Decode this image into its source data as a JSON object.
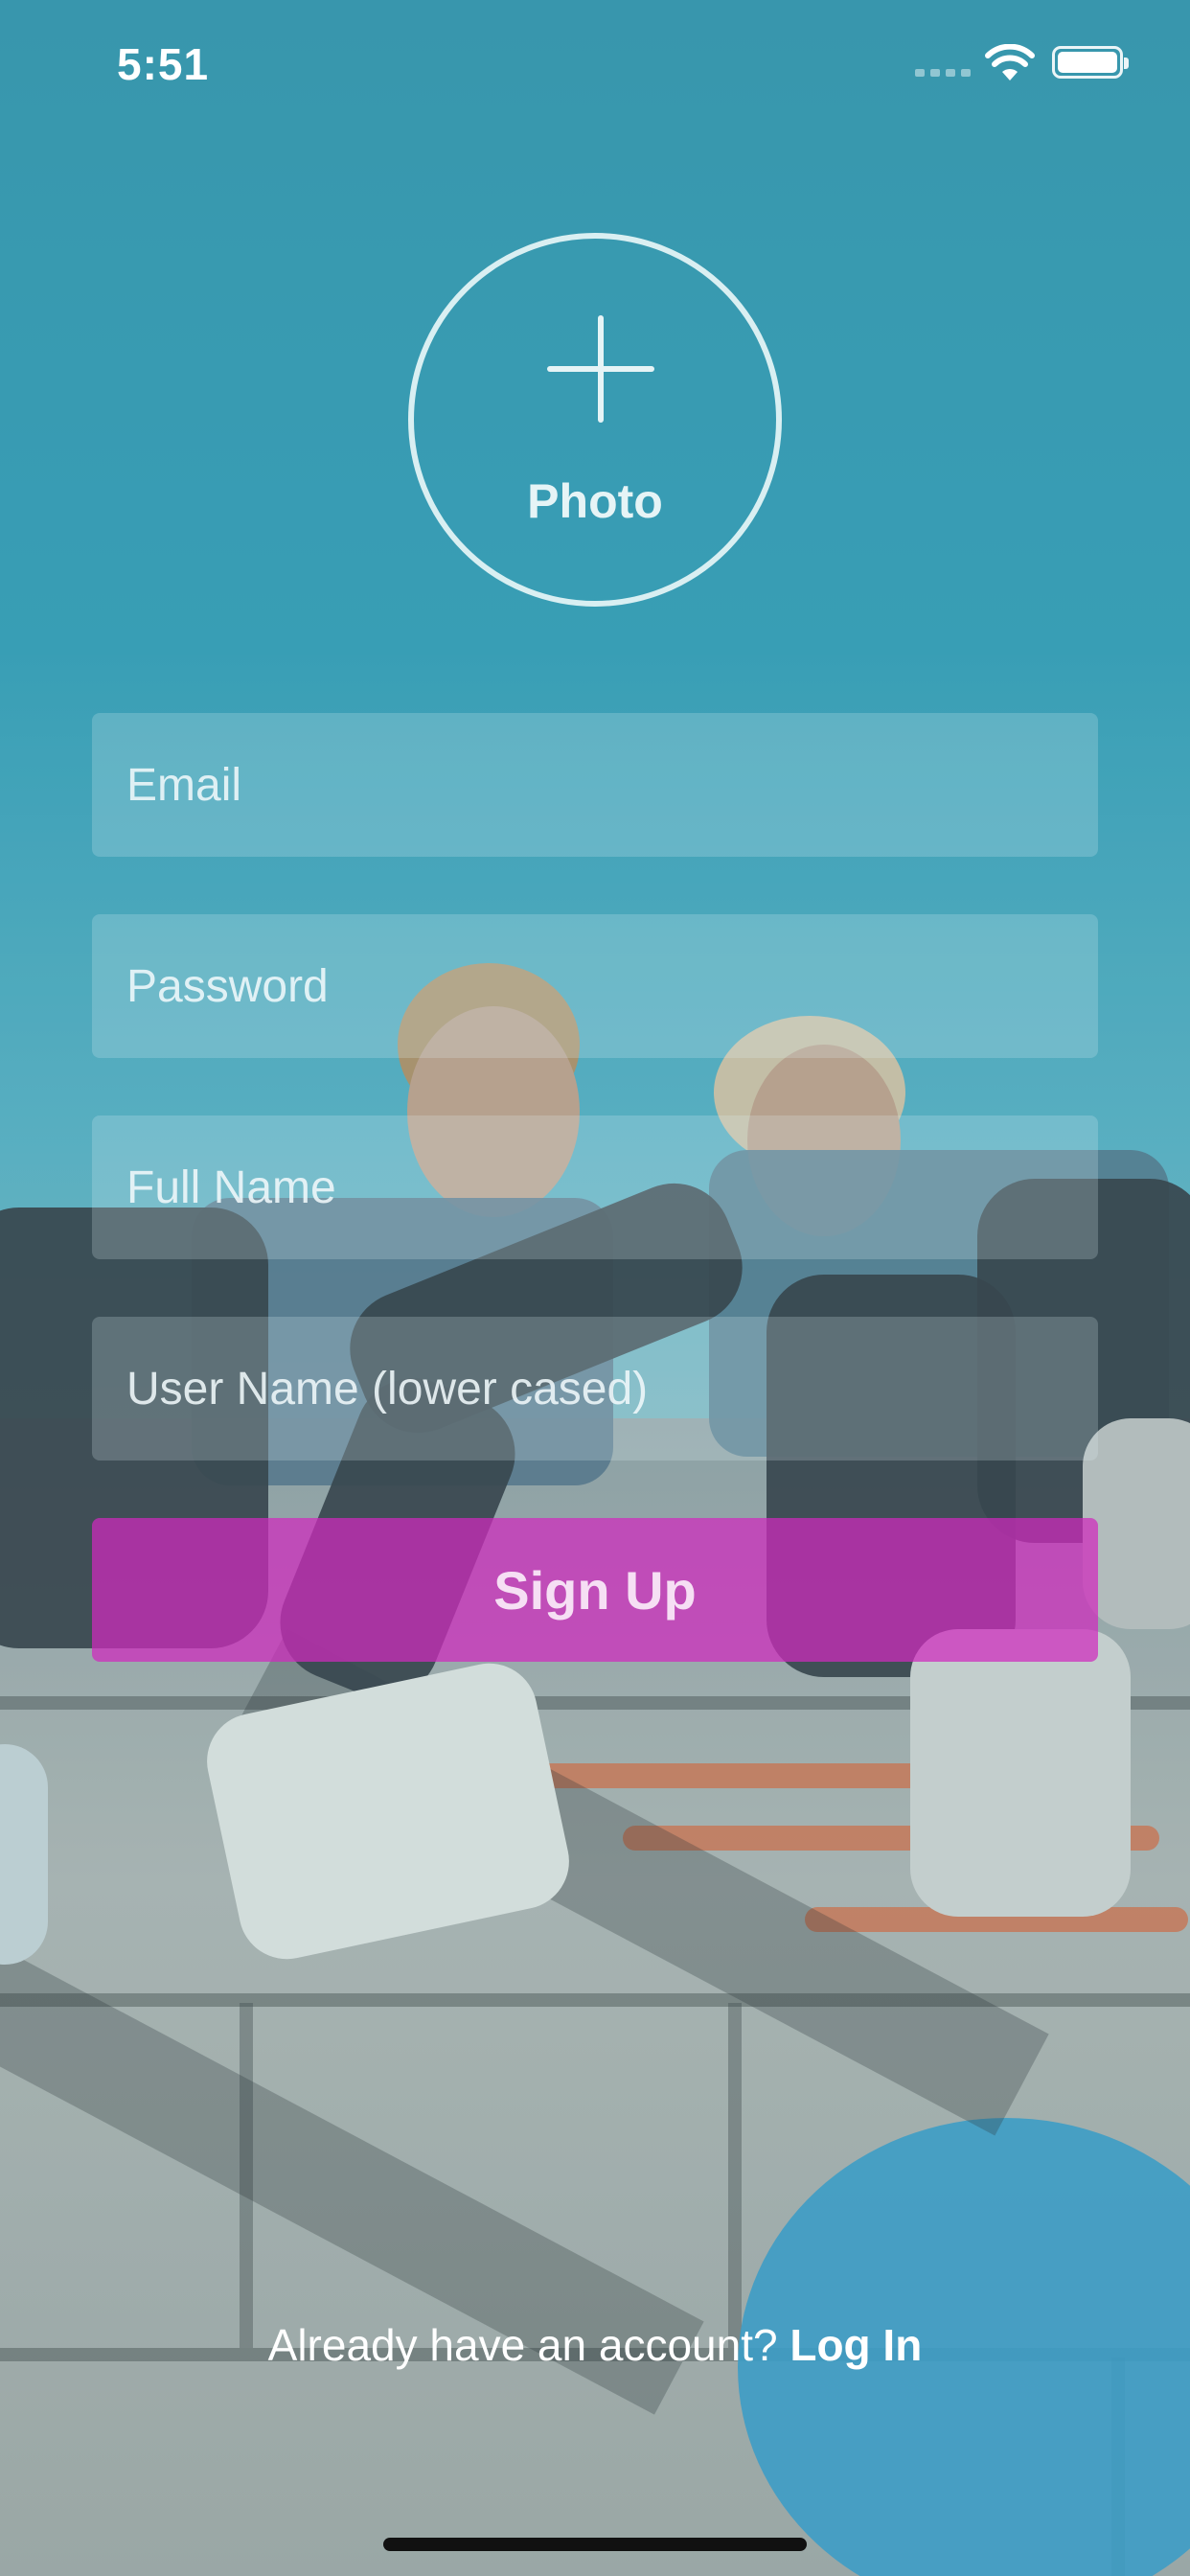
{
  "status_bar": {
    "time": "5:51"
  },
  "photo_picker": {
    "label": "Photo"
  },
  "form": {
    "email_placeholder": "Email",
    "password_placeholder": "Password",
    "fullname_placeholder": "Full Name",
    "username_placeholder": "User Name (lower cased)",
    "signup_label": "Sign Up"
  },
  "footer": {
    "prompt": "Already have an account? ",
    "login_label": "Log In"
  },
  "colors": {
    "accent": "#d02abe",
    "background_tint": "#3a9db4"
  }
}
